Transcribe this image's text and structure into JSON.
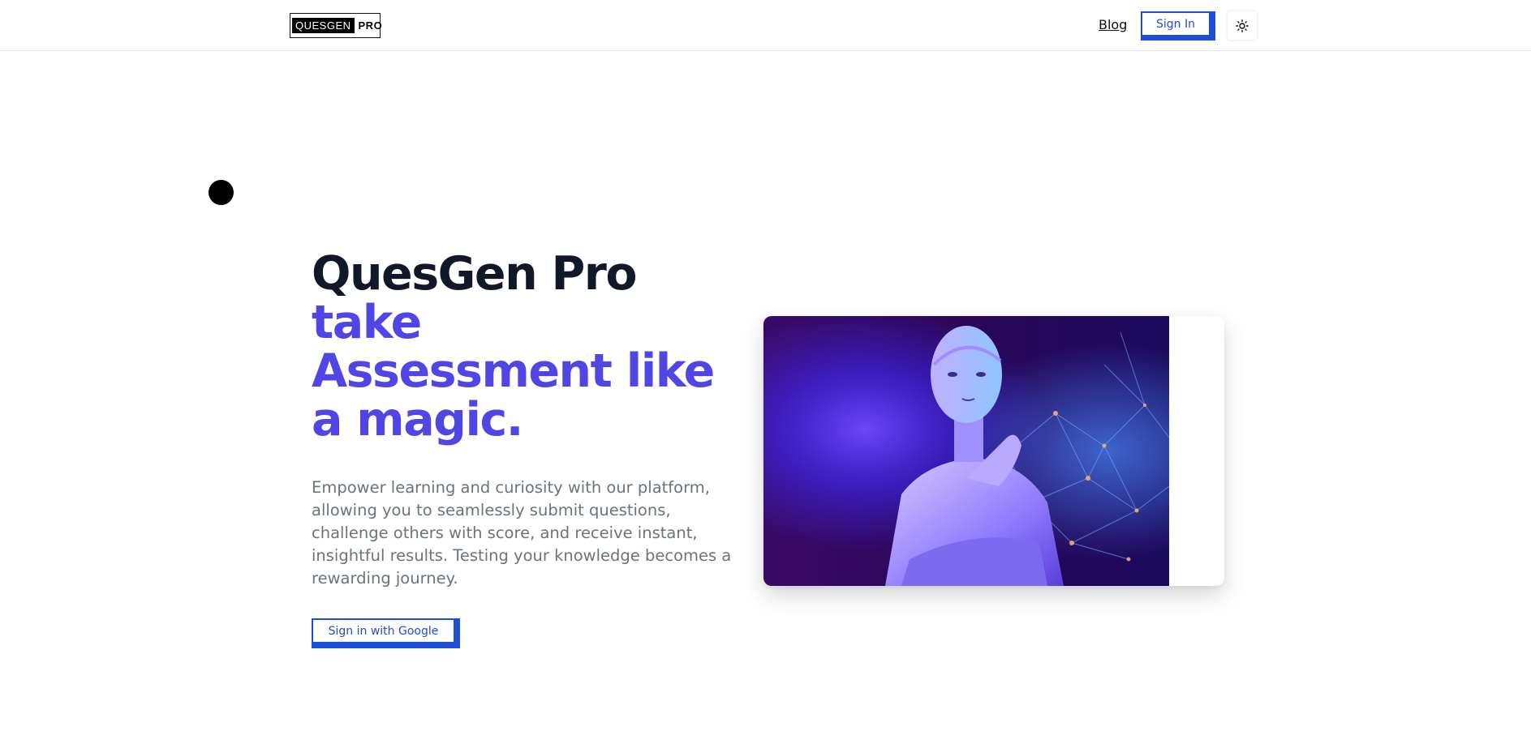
{
  "header": {
    "logo_left": "QUESGEN",
    "logo_right": "PRO",
    "blog_label": "Blog",
    "signin_label": "Sign In",
    "theme_icon": "sun-icon"
  },
  "hero": {
    "title_line1": "QuesGen Pro",
    "title_accent": "take Assessment like a magic.",
    "description": "Empower learning and curiosity with our platform, allowing you to seamlessly submit questions, challenge others with score, and receive instant, insightful results. Testing your knowledge becomes a rewarding journey.",
    "cta_label": "Sign in with Google"
  },
  "colors": {
    "accent": "#4f46e5",
    "button": "#1d4ed8",
    "heading": "#111827",
    "body_text": "#6b7280"
  }
}
